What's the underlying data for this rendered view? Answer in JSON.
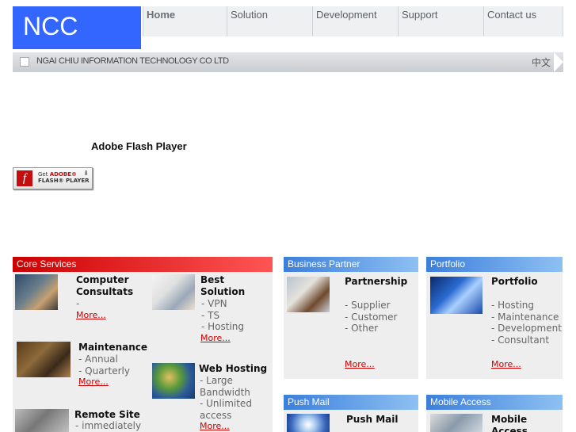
{
  "brand": {
    "logo_text": "NCC"
  },
  "nav": {
    "items": [
      {
        "label": "Home"
      },
      {
        "label": "Solution"
      },
      {
        "label": "Development"
      },
      {
        "label": "Support"
      },
      {
        "label": "Contact us"
      }
    ]
  },
  "tagline": {
    "company": "NGAI CHIU INFORMATION TECHNOLOGY CO LTD",
    "language": "中文"
  },
  "flash": {
    "title": "Adobe Flash Player",
    "badge_line1_prefix": "Get ",
    "badge_line1_brand": "ADOBE®",
    "badge_line2": "FLASH® PLAYER"
  },
  "colors": {
    "logo_bg": "#3366ff",
    "core_head": "#cc0000",
    "blue_head": "#3b7fdc",
    "more_link": "#cc0000"
  },
  "core_services": {
    "heading": "Core Services",
    "items": [
      {
        "title_line1": "Computer",
        "title_line2": "Consultats",
        "lines": [
          "-"
        ],
        "more": "More..."
      },
      {
        "title_line1": "Best",
        "title_line2": "Solution",
        "lines": [
          "- VPN",
          "- TS",
          "- Hosting"
        ],
        "more": "More..."
      },
      {
        "title_line1": "Maintenance",
        "title_line2": "",
        "lines": [
          "- Annual",
          "- Quarterly"
        ],
        "more": "More..."
      },
      {
        "title_line1": "Web Hosting",
        "title_line2": "",
        "lines": [
          "- Large",
          "Bandwidth",
          "- Unlimited",
          "access"
        ],
        "more": "More..."
      },
      {
        "title_line1": "Remote Site",
        "title_line2": "",
        "lines": [
          "- immediately"
        ],
        "more": ""
      }
    ]
  },
  "business_partner": {
    "heading": "Business Partner",
    "title": "Partnership",
    "lines": [
      "- Supplier",
      "- Customer",
      "- Other"
    ],
    "more": "More..."
  },
  "portfolio": {
    "heading": "Portfolio",
    "title": "Portfolio",
    "lines": [
      "- Hosting",
      "- Maintenance",
      "- Development",
      "- Consultant"
    ],
    "more": "More..."
  },
  "push_mail": {
    "heading": "Push Mail",
    "title": "Push Mail"
  },
  "mobile_access": {
    "heading": "Mobile Access",
    "title_line1": "Mobile",
    "title_line2": "Access"
  }
}
